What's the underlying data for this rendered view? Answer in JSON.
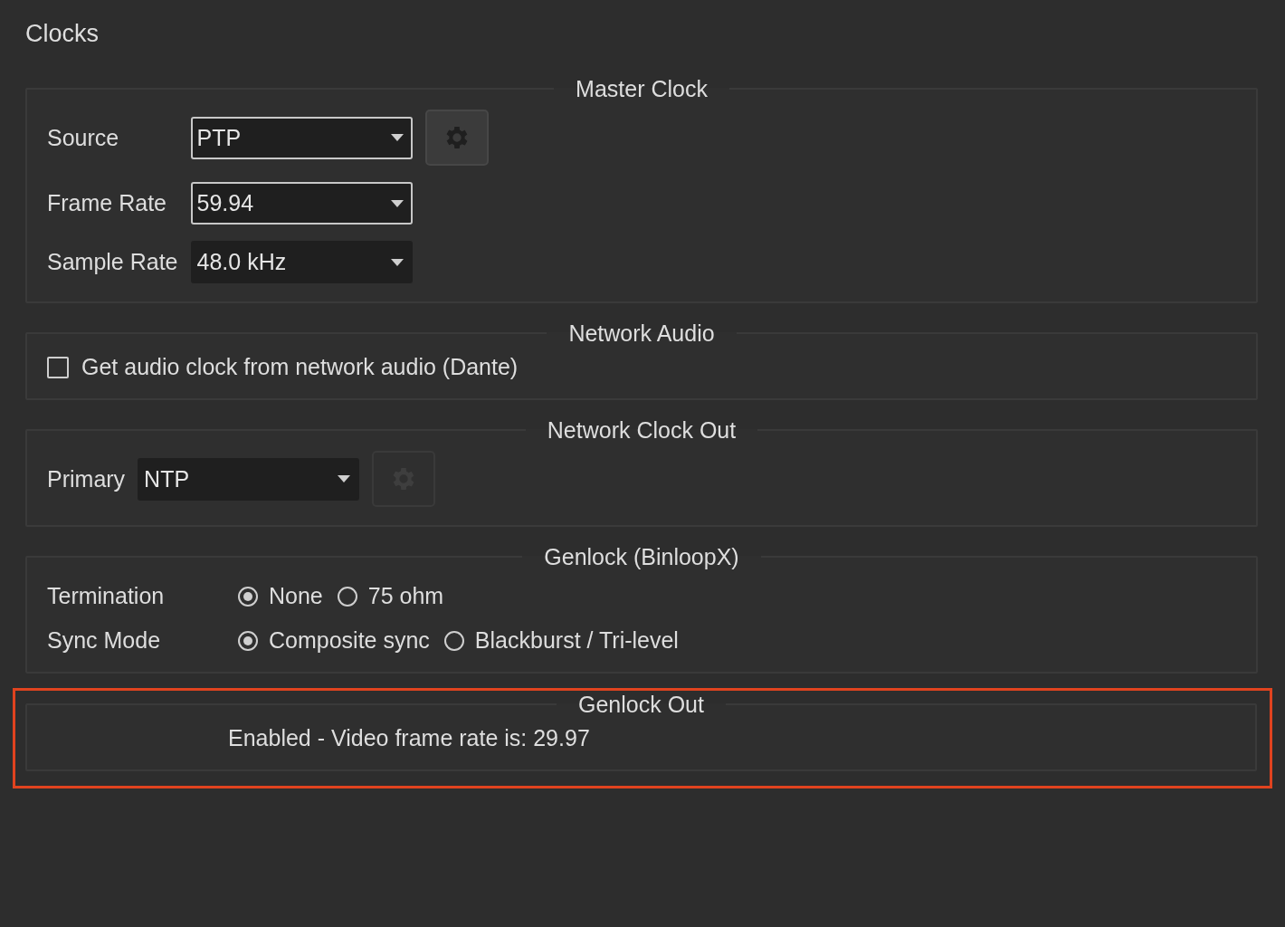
{
  "title": "Clocks",
  "groups": [
    {
      "legend": "Master Clock",
      "highlighted": false,
      "rows": [
        {
          "kind": "select",
          "label": "Source",
          "value": "PTP",
          "outlined": true,
          "settings_button": {
            "disabled": false
          }
        },
        {
          "kind": "select",
          "label": "Frame Rate",
          "value": "59.94",
          "outlined": true
        },
        {
          "kind": "select",
          "label": "Sample Rate",
          "value": "48.0 kHz",
          "outlined": false
        }
      ]
    },
    {
      "legend": "Network Audio",
      "highlighted": false,
      "rows": [
        {
          "kind": "checkbox",
          "label": "Get audio clock from network audio (Dante)",
          "checked": false
        }
      ]
    },
    {
      "legend": "Network Clock Out",
      "highlighted": false,
      "rows": [
        {
          "kind": "select",
          "label": "Primary",
          "value": "NTP",
          "outlined": false,
          "settings_button": {
            "disabled": true
          }
        }
      ]
    },
    {
      "legend": "Genlock (BinloopX)",
      "highlighted": false,
      "rows": [
        {
          "kind": "radios",
          "label": "Termination",
          "options": [
            {
              "label": "None",
              "selected": true
            },
            {
              "label": "75 ohm",
              "selected": false
            }
          ]
        },
        {
          "kind": "radios",
          "label": "Sync Mode",
          "options": [
            {
              "label": "Composite sync",
              "selected": true
            },
            {
              "label": "Blackburst / Tri-level",
              "selected": false
            }
          ]
        }
      ]
    },
    {
      "legend": "Genlock Out",
      "highlighted": true,
      "rows": [
        {
          "kind": "text",
          "text": "Enabled - Video frame rate is: 29.97"
        }
      ]
    }
  ]
}
